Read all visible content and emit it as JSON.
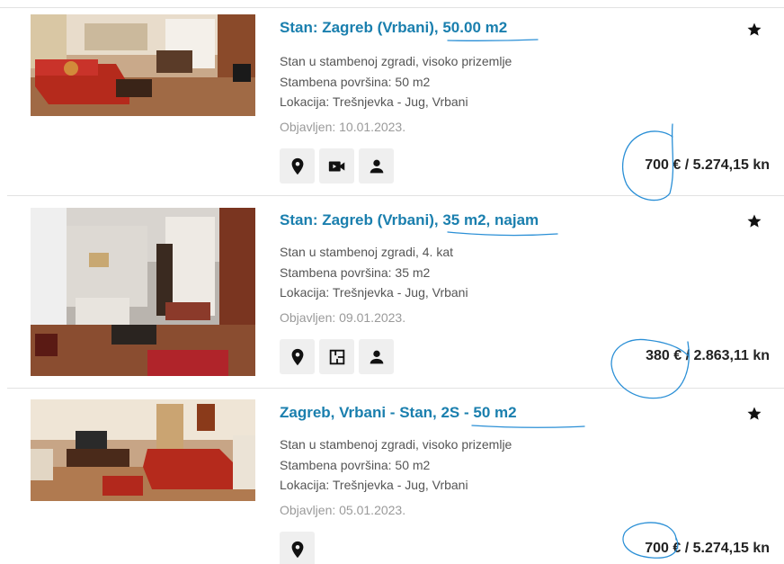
{
  "listings": [
    {
      "title": "Stan: Zagreb (Vrbani), 50.00 m2",
      "desc": [
        "Stan u stambenoj zgradi, visoko prizemlje",
        "Stambena površina: 50 m2",
        "Lokacija: Trešnjevka - Jug, Vrbani"
      ],
      "date": "Objavljen: 10.01.2023.",
      "price": "700 € / 5.274,15 kn",
      "actions": [
        "location-pin-icon",
        "video-camera-icon",
        "person-icon"
      ]
    },
    {
      "title": "Stan: Zagreb (Vrbani), 35 m2, najam",
      "desc": [
        "Stan u stambenoj zgradi, 4. kat",
        "Stambena površina: 35 m2",
        "Lokacija: Trešnjevka - Jug, Vrbani"
      ],
      "date": "Objavljen: 09.01.2023.",
      "price": "380 € / 2.863,11 kn",
      "actions": [
        "location-pin-icon",
        "floor-plan-icon",
        "person-icon"
      ]
    },
    {
      "title": "Zagreb, Vrbani - Stan, 2S - 50 m2",
      "desc": [
        "Stan u stambenoj zgradi, visoko prizemlje",
        "Stambena površina: 50 m2",
        "Lokacija: Trešnjevka - Jug, Vrbani"
      ],
      "date": "Objavljen: 05.01.2023.",
      "price": "700 € / 5.274,15 kn",
      "actions": [
        "location-pin-icon"
      ]
    }
  ],
  "colors": {
    "title": "#1a7fae",
    "annotation": "#2a8fd6",
    "button_bg": "#efefef"
  }
}
